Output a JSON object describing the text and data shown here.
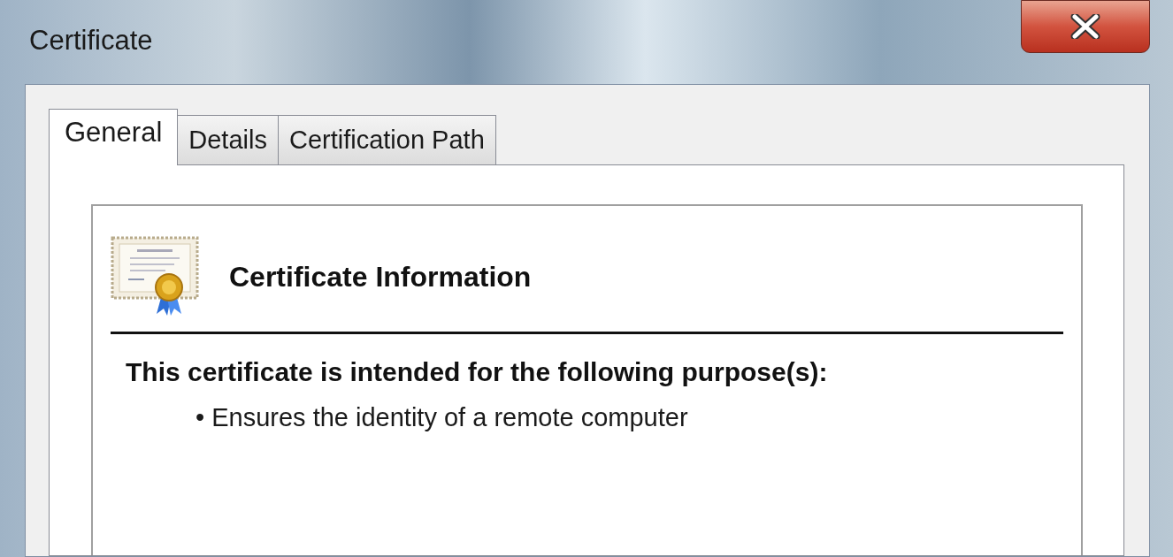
{
  "window": {
    "title": "Certificate"
  },
  "tabs": [
    {
      "label": "General",
      "selected": true
    },
    {
      "label": "Details",
      "selected": false
    },
    {
      "label": "Certification Path",
      "selected": false
    }
  ],
  "panel": {
    "heading": "Certificate Information",
    "intro": "This certificate is intended for the following purpose(s):",
    "purposes": [
      "• Ensures the identity of a remote computer"
    ]
  }
}
